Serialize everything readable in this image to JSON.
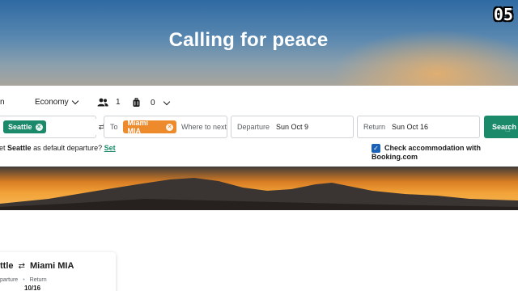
{
  "hero": {
    "title": "Calling for peace",
    "badge": "05"
  },
  "options": {
    "trip_type_partial": "n",
    "cabin_class": "Economy",
    "passengers": "1",
    "bags": "0"
  },
  "origin": {
    "city": "Seattle"
  },
  "destination": {
    "label": "To",
    "city": "Miami MIA",
    "placeholder": "Where to next?"
  },
  "departure": {
    "label": "Departure",
    "value": "Sun Oct 9"
  },
  "return": {
    "label": "Return",
    "value": "Sun Oct 16"
  },
  "search_label": "Search",
  "default_prompt": {
    "prefix": "et",
    "city": "Seattle",
    "suffix": "as default departure?",
    "link": "Set"
  },
  "accommodation": {
    "label": "Check accommodation with Booking.com",
    "checked": true
  },
  "result_card": {
    "from": "ttle",
    "to": "Miami MIA",
    "departure_label": "parture",
    "return_label": "Return",
    "return_date": "10/16"
  },
  "colors": {
    "accent_green": "#1a8a6a",
    "origin_chip": "#1a8a6a",
    "destination_chip": "#ec8a2c",
    "checkbox_blue": "#1a62b8"
  }
}
